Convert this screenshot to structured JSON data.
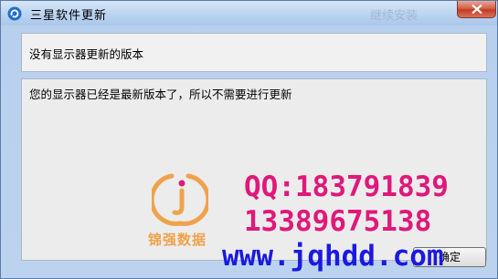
{
  "window": {
    "title": "三星软件更新",
    "title_ghost": "继续安装",
    "close_icon": "close-icon",
    "app_icon": "refresh-icon"
  },
  "dialog": {
    "heading": "没有显示器更新的版本",
    "message": "您的显示器已经是最新版本了，所以不需要进行更新",
    "ok_label": "确定"
  },
  "watermark": {
    "logo_text": "锦强数据",
    "qq": "QQ:183791839",
    "phone": "13389675138",
    "url": "www.jqhdd.com",
    "logo_color": "#f0a24a",
    "text_color": "#e0187a",
    "url_color": "#1a1ae0"
  }
}
